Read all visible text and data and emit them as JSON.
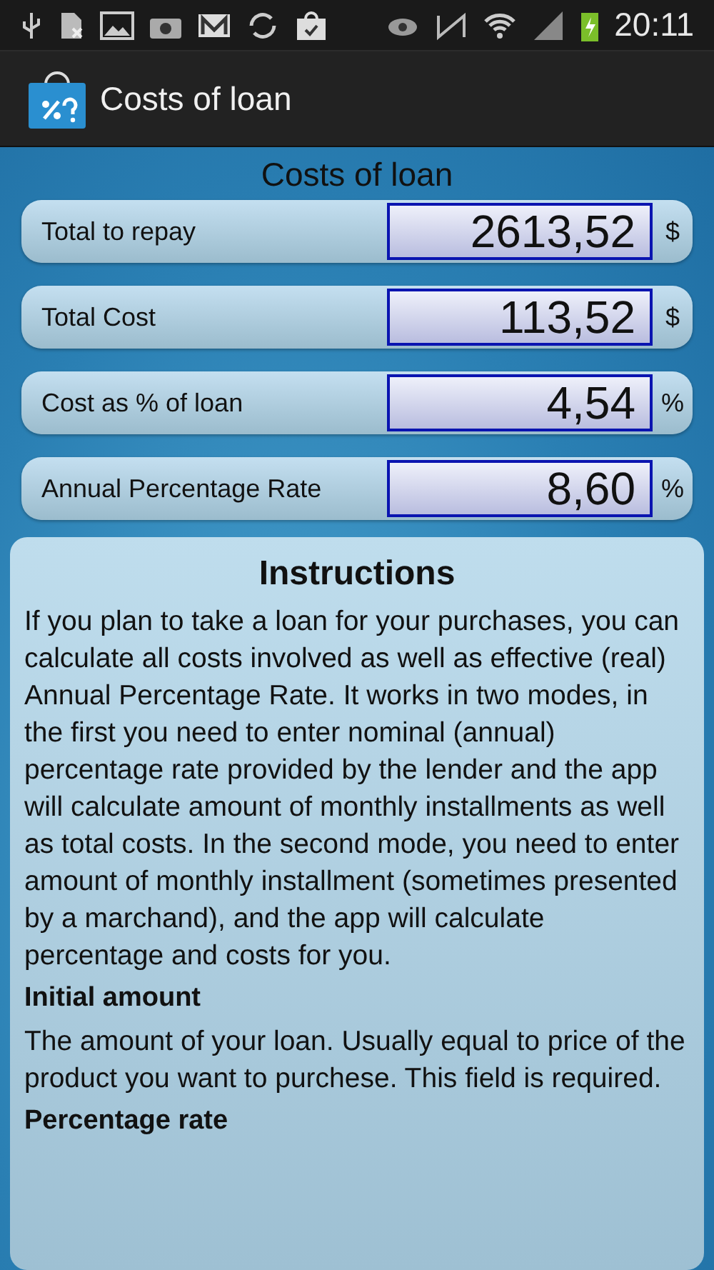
{
  "status_bar": {
    "time": "20:11"
  },
  "action_bar": {
    "title": "Costs of loan"
  },
  "results": {
    "title": "Costs of loan",
    "rows": [
      {
        "label": "Total to repay",
        "value": "2613,52",
        "unit": "$"
      },
      {
        "label": "Total Cost",
        "value": "113,52",
        "unit": "$"
      },
      {
        "label": "Cost as % of loan",
        "value": "4,54",
        "unit": "%"
      },
      {
        "label": "Annual Percentage Rate",
        "value": "8,60",
        "unit": "%"
      }
    ]
  },
  "instructions": {
    "title": "Instructions",
    "sections": [
      {
        "kind": "paragraph",
        "text": "If you plan to take a loan for your purchases, you can calculate all costs involved as well as effective (real) Annual Percentage Rate. It works in two modes, in the first you need to enter nominal (annual) percentage rate provided by the lender and the app will calculate amount of monthly installments as well as total costs. In the second mode, you need to enter amount of monthly installment (sometimes presented by a marchand), and the app will calculate percentage and costs for you."
      },
      {
        "kind": "heading",
        "text": "Initial amount"
      },
      {
        "kind": "paragraph",
        "text": "The amount of your loan. Usually equal to price of the product you want to purchese. This field is required."
      },
      {
        "kind": "heading",
        "text": "Percentage rate"
      }
    ]
  }
}
